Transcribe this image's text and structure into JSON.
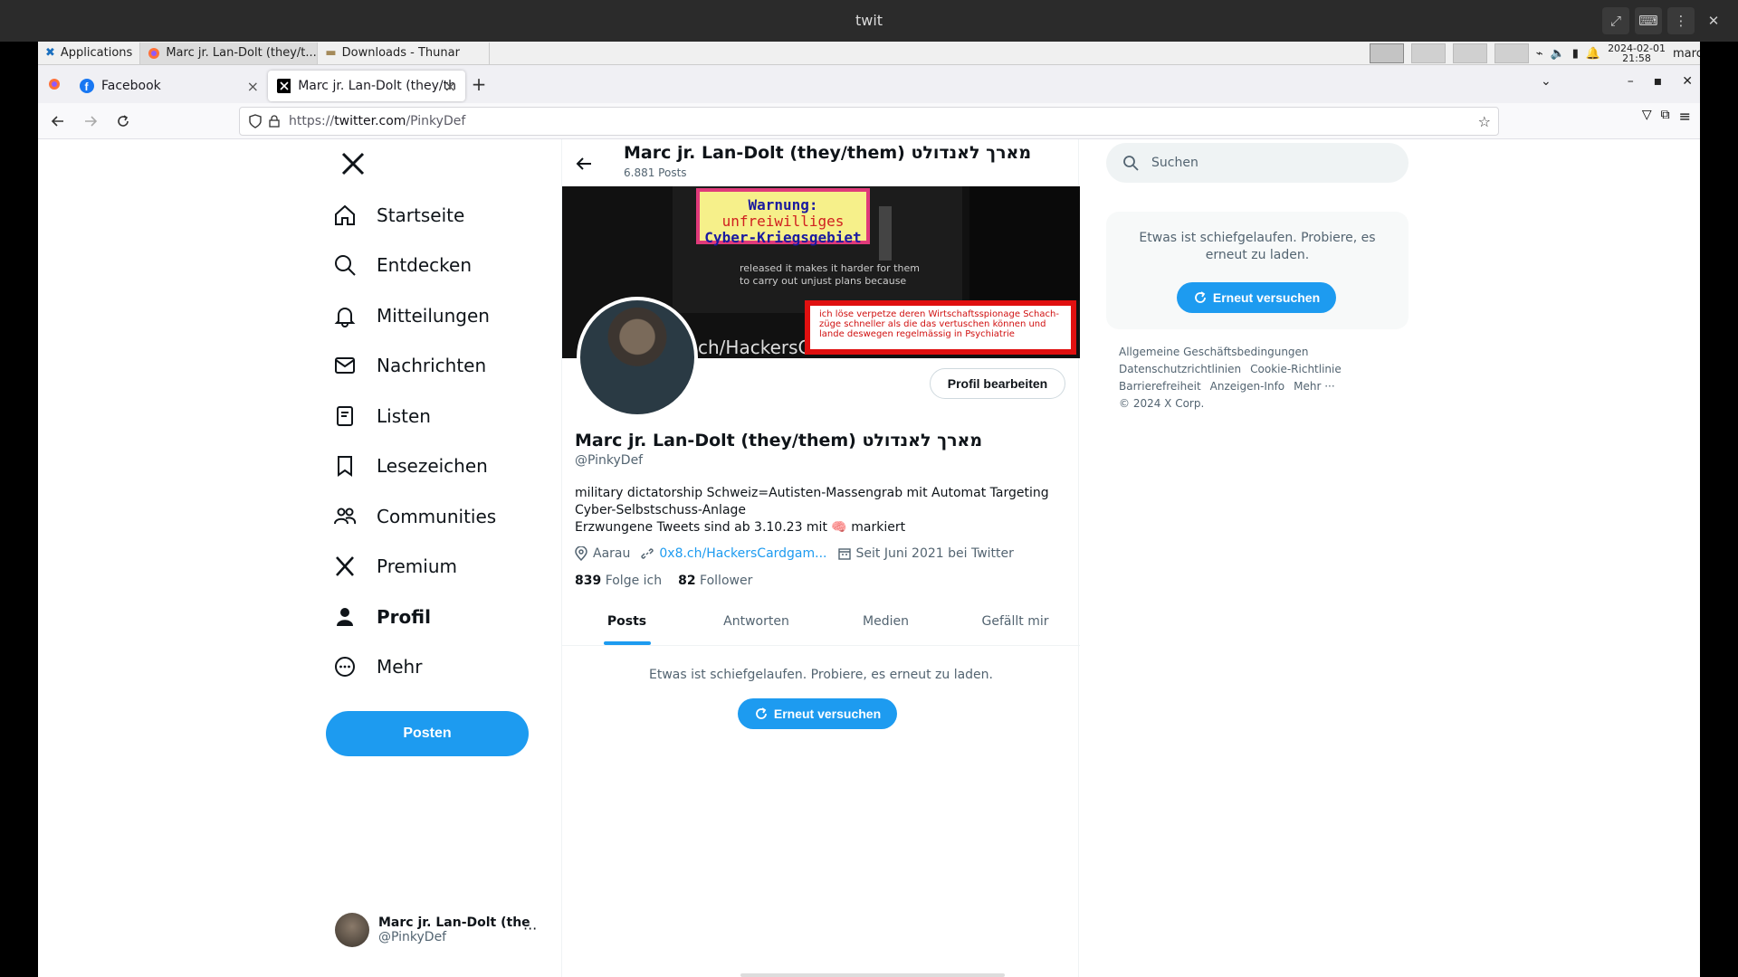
{
  "window": {
    "title": "twit"
  },
  "taskbar": {
    "applications": "Applications",
    "tasks": [
      "Marc jr. Lan-Dolt (they/t...",
      "Downloads - Thunar"
    ],
    "date": "2024-02-01",
    "time": "21:58",
    "user": "marc"
  },
  "browser": {
    "tabs": [
      {
        "label": "Facebook"
      },
      {
        "label": "Marc jr. Lan-Dolt (they/th"
      }
    ],
    "url_scheme": "https://",
    "url_host": "twitter.com",
    "url_path": "/PinkyDef"
  },
  "nav": {
    "items": [
      "Startseite",
      "Entdecken",
      "Mitteilungen",
      "Nachrichten",
      "Listen",
      "Lesezeichen",
      "Communities",
      "Premium",
      "Profil",
      "Mehr"
    ],
    "post_label": "Posten",
    "account_name": "Marc jr. Lan-Dolt (the",
    "account_handle": "@PinkyDef"
  },
  "profile": {
    "header_name": "Marc jr. Lan-Dolt (they/them) מארך לאנדולט",
    "post_count": "6.881 Posts",
    "banner_warning_1": "Warnung:",
    "banner_warning_2": "unfreiwilliges",
    "banner_warning_3": "Cyber-Kriegsgebiet",
    "banner_subtitle": "released it makes it harder for them to carry out unjust plans because",
    "banner_redbox": "ich löse verpetze deren Wirtschaftsspionage Schach-züge schneller als die das vertuschen können und lande deswegen regelmässig in Psychiatrie",
    "banner_bottom": "ch/HackersC",
    "edit_label": "Profil bearbeiten",
    "name": "Marc jr. Lan-Dolt (they/them) מארך לאנדולט",
    "handle": "@PinkyDef",
    "bio_line1": "military dictatorship Schweiz=Autisten-Massengrab mit Automat Targeting Cyber-Selbstschuss-Anlage",
    "bio_line2_pre": "Erzwungene Tweets sind ab 3.10.23 mit",
    "bio_line2_emoji": "🧠",
    "bio_line2_post": "markiert",
    "location": "Aarau",
    "link": "0x8.ch/HackersCardgam...",
    "joined": "Seit Juni 2021 bei Twitter",
    "following_count": "839",
    "following_label": "Folge ich",
    "followers_count": "82",
    "followers_label": "Follower",
    "tabs": [
      "Posts",
      "Antworten",
      "Medien",
      "Gefällt mir"
    ],
    "error_text": "Etwas ist schiefgelaufen. Probiere, es erneut zu laden.",
    "retry_label": "Erneut versuchen"
  },
  "sidebar": {
    "search_placeholder": "Suchen",
    "error_text": "Etwas ist schiefgelaufen. Probiere, es erneut zu laden.",
    "retry_label": "Erneut versuchen",
    "footer": [
      "Allgemeine Geschäftsbedingungen",
      "Datenschutzrichtlinien",
      "Cookie-Richtlinie",
      "Barrierefreiheit",
      "Anzeigen-Info",
      "Mehr ···",
      "© 2024 X Corp."
    ]
  },
  "colors": {
    "accent": "#1d9bf0",
    "text": "#0f1419",
    "muted": "#536471"
  }
}
